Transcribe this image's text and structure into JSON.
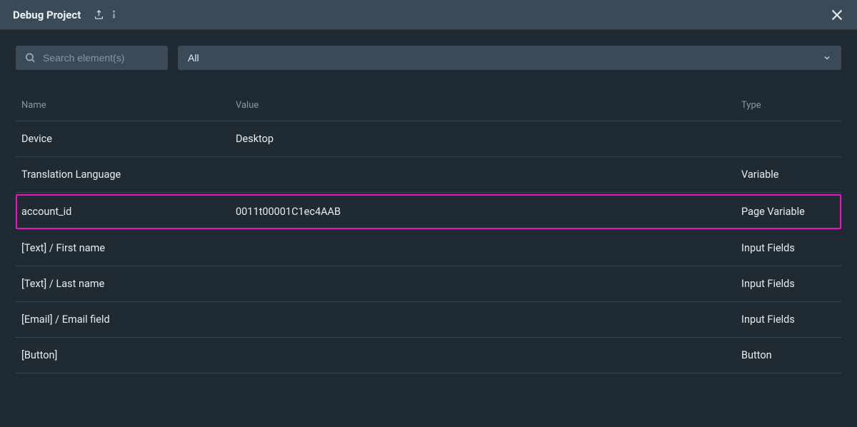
{
  "header": {
    "title": "Debug Project"
  },
  "search": {
    "placeholder": "Search element(s)"
  },
  "filter": {
    "selected": "All"
  },
  "table": {
    "headers": {
      "name": "Name",
      "value": "Value",
      "type": "Type"
    },
    "rows": [
      {
        "name": "Device",
        "value": "Desktop",
        "type": "",
        "highlight": false
      },
      {
        "name": "Translation Language",
        "value": "",
        "type": "Variable",
        "highlight": false
      },
      {
        "name": "account_id",
        "value": "0011t00001C1ec4AAB",
        "type": "Page Variable",
        "highlight": true
      },
      {
        "name": "[Text] / First name",
        "value": "",
        "type": "Input Fields",
        "highlight": false
      },
      {
        "name": "[Text] / Last name",
        "value": "",
        "type": "Input Fields",
        "highlight": false
      },
      {
        "name": "[Email] / Email field",
        "value": "",
        "type": "Input Fields",
        "highlight": false
      },
      {
        "name": "[Button]",
        "value": "",
        "type": "Button",
        "highlight": false
      }
    ]
  }
}
